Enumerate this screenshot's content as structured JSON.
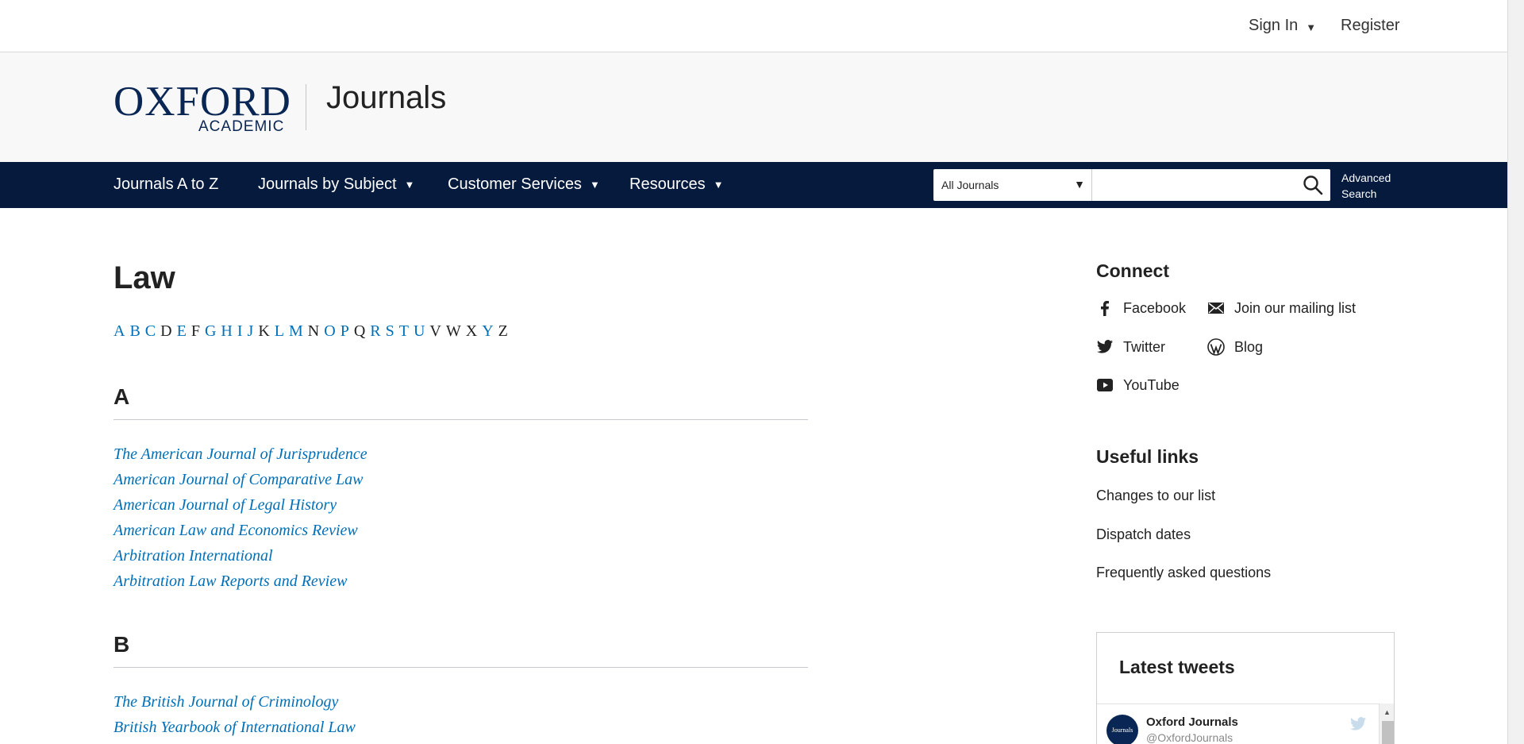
{
  "topbar": {
    "sign_in": "Sign In",
    "register": "Register"
  },
  "brand": {
    "logo_main": "OXFORD",
    "logo_sub": "ACADEMIC",
    "title": "Journals"
  },
  "nav": {
    "items": [
      {
        "label": "Journals A to Z",
        "has_caret": false
      },
      {
        "label": "Journals by Subject",
        "has_caret": true
      },
      {
        "label": "Customer Services",
        "has_caret": true
      },
      {
        "label": "Resources",
        "has_caret": true
      }
    ],
    "search_scope": "All Journals",
    "search_placeholder": "",
    "advanced_search_line1": "Advanced",
    "advanced_search_line2": "Search"
  },
  "main": {
    "title": "Law",
    "alphabet": [
      {
        "letter": "A",
        "link": true
      },
      {
        "letter": "B",
        "link": true
      },
      {
        "letter": "C",
        "link": true
      },
      {
        "letter": "D",
        "link": false
      },
      {
        "letter": "E",
        "link": true
      },
      {
        "letter": "F",
        "link": false
      },
      {
        "letter": "G",
        "link": true
      },
      {
        "letter": "H",
        "link": true
      },
      {
        "letter": "I",
        "link": true
      },
      {
        "letter": "J",
        "link": true
      },
      {
        "letter": "K",
        "link": false
      },
      {
        "letter": "L",
        "link": true
      },
      {
        "letter": "M",
        "link": true
      },
      {
        "letter": "N",
        "link": false
      },
      {
        "letter": "O",
        "link": true
      },
      {
        "letter": "P",
        "link": true
      },
      {
        "letter": "Q",
        "link": false
      },
      {
        "letter": "R",
        "link": true
      },
      {
        "letter": "S",
        "link": true
      },
      {
        "letter": "T",
        "link": true
      },
      {
        "letter": "U",
        "link": true
      },
      {
        "letter": "V",
        "link": false
      },
      {
        "letter": "W",
        "link": false
      },
      {
        "letter": "X",
        "link": false
      },
      {
        "letter": "Y",
        "link": true
      },
      {
        "letter": "Z",
        "link": false
      }
    ],
    "sections": [
      {
        "letter": "A",
        "journals": [
          "The American Journal of Jurisprudence",
          "American Journal of Comparative Law",
          "American Journal of Legal History",
          "American Law and Economics Review",
          "Arbitration International",
          "Arbitration Law Reports and Review"
        ]
      },
      {
        "letter": "B",
        "journals": [
          "The British Journal of Criminology",
          "British Yearbook of International Law"
        ]
      }
    ]
  },
  "sidebar": {
    "connect_title": "Connect",
    "connect": {
      "facebook": "Facebook",
      "mailing": "Join our mailing list",
      "twitter": "Twitter",
      "blog": "Blog",
      "youtube": "YouTube"
    },
    "useful_title": "Useful links",
    "useful_links": [
      "Changes to our list",
      "Dispatch dates",
      "Frequently asked questions"
    ],
    "tweets": {
      "title": "Latest tweets",
      "account_name": "Oxford Journals",
      "account_handle": "@OxfordJournals",
      "avatar_text": "Journals"
    }
  },
  "colors": {
    "navy": "#051a3d",
    "link": "#006fb7",
    "brand": "#0a2654"
  }
}
